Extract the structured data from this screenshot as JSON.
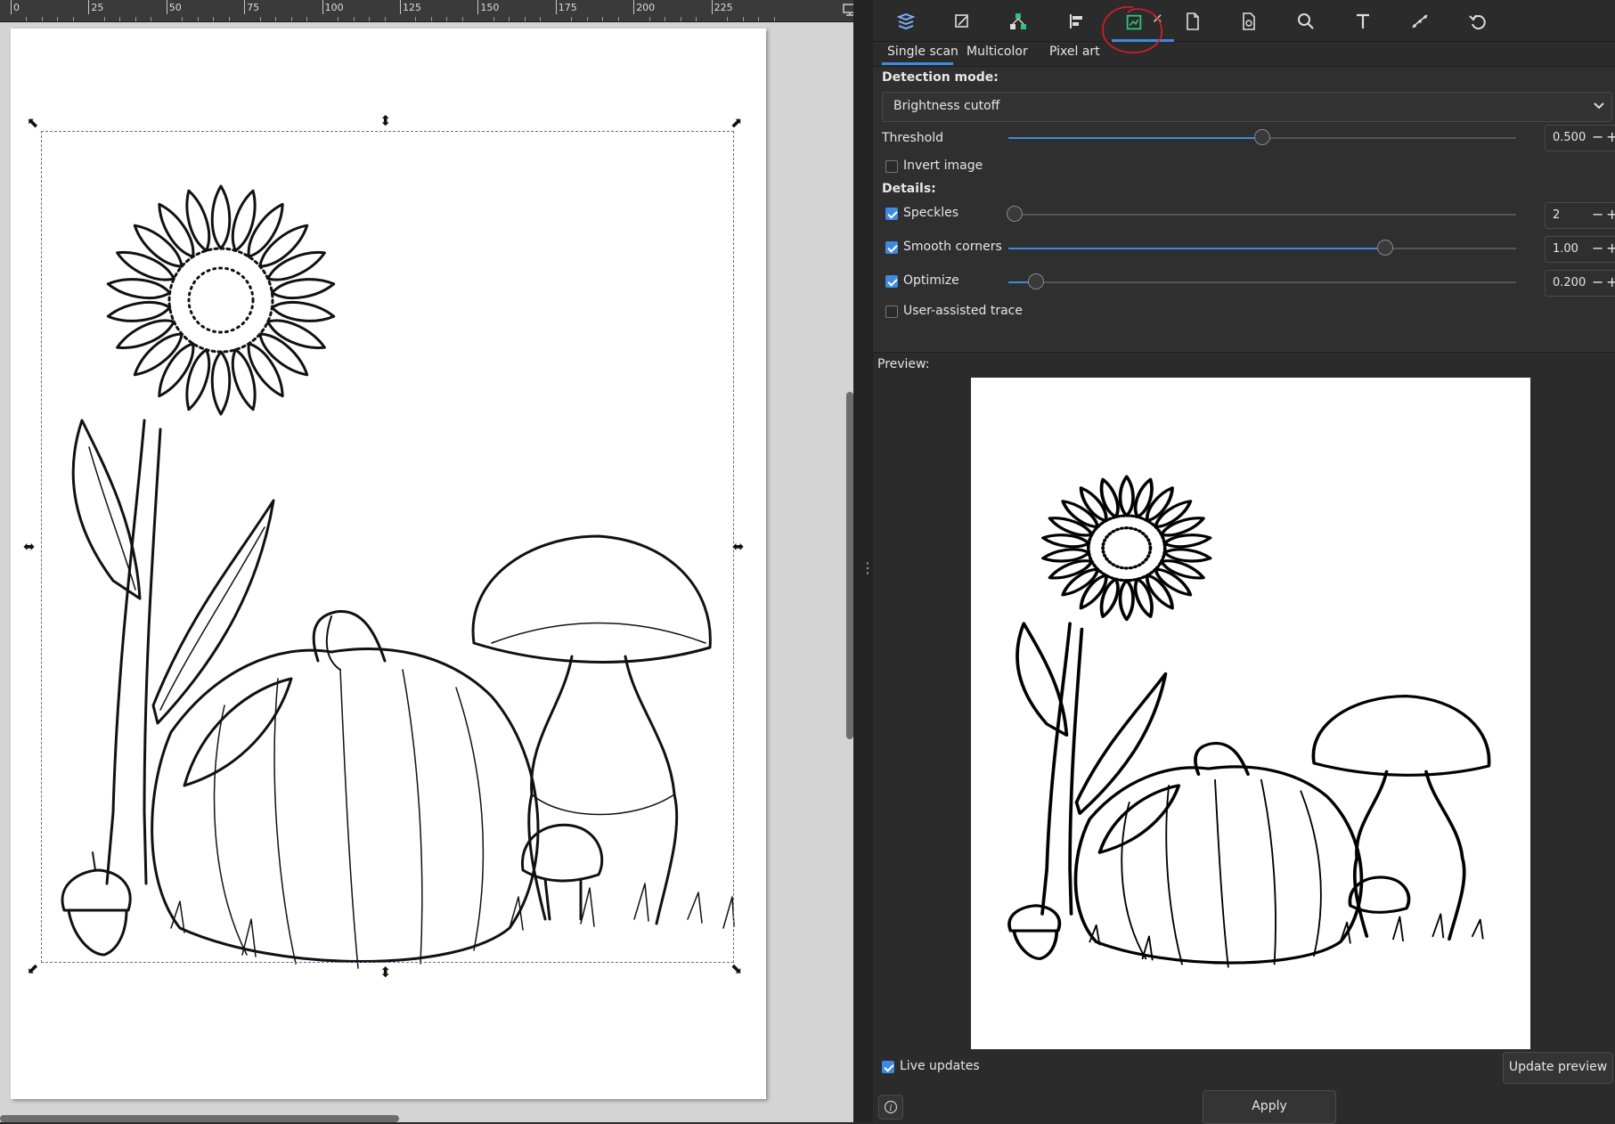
{
  "ruler": {
    "labels": [
      "0",
      "25",
      "50",
      "75",
      "100",
      "125",
      "150",
      "175",
      "200",
      "225"
    ]
  },
  "dock": {
    "icons": [
      "layers-icon",
      "fill-stroke-icon",
      "xml-editor-icon",
      "align-icon",
      "trace-bitmap-icon",
      "document-properties-icon",
      "export-icon",
      "find-icon",
      "text-font-icon",
      "path-effects-icon",
      "undo-history-icon"
    ],
    "active_tab_icon": "trace-bitmap-icon",
    "close_symbol": "✕"
  },
  "trace": {
    "tabs": [
      "Single scan",
      "Multicolor",
      "Pixel art"
    ],
    "active_tab": "Single scan",
    "detection_mode_label": "Detection mode:",
    "detection_mode_value": "Brightness cutoff",
    "threshold_label": "Threshold",
    "threshold_value": "0.500",
    "threshold_level": 0.5,
    "invert_label": "Invert image",
    "invert_checked": false,
    "details_label": "Details:",
    "speckles_label": "Speckles",
    "speckles_checked": true,
    "speckles_value": "2",
    "speckles_level": 0.0,
    "smooth_label": "Smooth corners",
    "smooth_checked": true,
    "smooth_value": "1.00",
    "smooth_level": 0.75,
    "optimize_label": "Optimize",
    "optimize_checked": true,
    "optimize_value": "0.200",
    "optimize_level": 0.04,
    "user_assisted_label": "User-assisted trace",
    "user_assisted_checked": false,
    "preview_label": "Preview:",
    "live_updates_label": "Live updates",
    "live_updates_checked": true,
    "update_preview_label": "Update preview",
    "apply_label": "Apply"
  },
  "colors": {
    "accent": "#3f8ae0",
    "panel_bg": "#2b2b2b",
    "annotation": "#e01b24"
  }
}
